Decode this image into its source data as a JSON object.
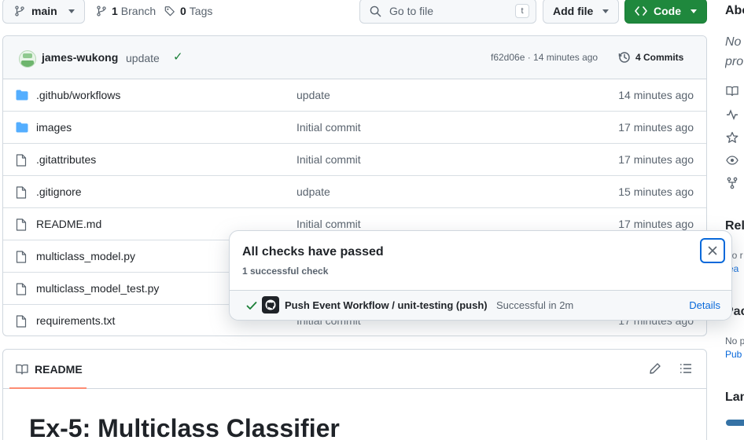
{
  "toolbar": {
    "branch": "main",
    "branch_count": "1",
    "branch_label": "Branch",
    "tag_count": "0",
    "tag_label": "Tags",
    "search_placeholder": "Go to file",
    "search_shortcut": "t",
    "add_file": "Add file",
    "code": "Code"
  },
  "commit": {
    "author": "james-wukong",
    "message": "update",
    "sha_time": "f62d06e · 14 minutes ago",
    "commits_label": "4 Commits"
  },
  "files": [
    {
      "type": "dir",
      "name": ".github/workflows",
      "message": "update",
      "age": "14 minutes ago"
    },
    {
      "type": "dir",
      "name": "images",
      "message": "Initial commit",
      "age": "17 minutes ago"
    },
    {
      "type": "file",
      "name": ".gitattributes",
      "message": "Initial commit",
      "age": "17 minutes ago"
    },
    {
      "type": "file",
      "name": ".gitignore",
      "message": "udpate",
      "age": "15 minutes ago"
    },
    {
      "type": "file",
      "name": "README.md",
      "message": "Initial commit",
      "age": "17 minutes ago"
    },
    {
      "type": "file",
      "name": "multiclass_model.py",
      "message": "",
      "age": ""
    },
    {
      "type": "file",
      "name": "multiclass_model_test.py",
      "message": "",
      "age": ""
    },
    {
      "type": "file",
      "name": "requirements.txt",
      "message": "Initial commit",
      "age": "17 minutes ago"
    }
  ],
  "readme": {
    "tab": "README",
    "title": "Ex-5: Multiclass Classifier"
  },
  "sidebar": {
    "about": "Abo",
    "desc_line1": "No",
    "desc_line2": "pro",
    "releases": "Rel",
    "releases_text": "No r",
    "releases_link": "rea",
    "packages": "Pac",
    "packages_text": "No p",
    "packages_link": "Pub",
    "languages": "Lan"
  },
  "modal": {
    "title": "All checks have passed",
    "subtitle": "1 successful check",
    "check_name": "Push Event Workflow / unit-testing (push)",
    "check_status": "Successful in 2m",
    "details": "Details"
  },
  "colors": {
    "accent": "#0969da",
    "success": "#1a7f37",
    "code_button": "#1f883d",
    "folder": "#54aeff",
    "readme_underline": "#fd8c73",
    "language_bar": "#3572a5"
  }
}
